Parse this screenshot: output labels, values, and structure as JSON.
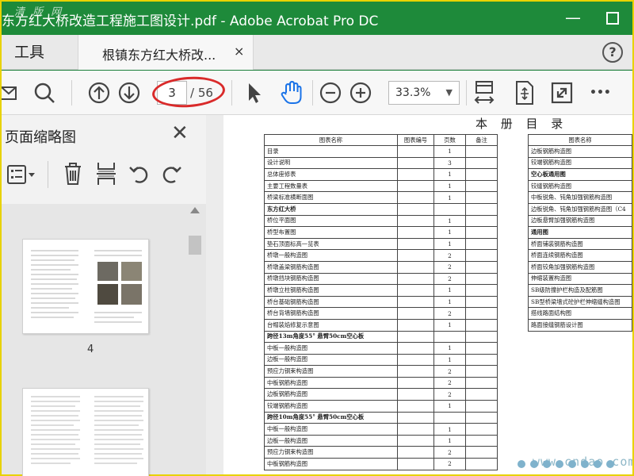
{
  "window": {
    "title": "东方红大桥改造工程施工图设计.pdf - Adobe Acrobat Pro DC",
    "watermark": "清 版 网",
    "minimize": "—",
    "close": "✕"
  },
  "tabs": {
    "tools_label": "工具",
    "doc_label": "根镇东方红大桥改...",
    "doc_close": "×",
    "help": "?"
  },
  "toolbar": {
    "current_page": "3",
    "total_pages": "/ 56",
    "zoom": "33.3%",
    "more": "•••"
  },
  "sidebar": {
    "title": "页面缩略图",
    "close": "✕",
    "visible_page_number": "4"
  },
  "document": {
    "heading": "本 册 目 录",
    "left_table": {
      "headers": [
        "图表名称",
        "图表编号",
        "页数",
        "备注"
      ],
      "rows": [
        {
          "name": "目录",
          "pages": "1",
          "bold": false
        },
        {
          "name": "设计说明",
          "pages": "3",
          "bold": false
        },
        {
          "name": "总体座修表",
          "pages": "1",
          "bold": false
        },
        {
          "name": "主要工程数量表",
          "pages": "1",
          "bold": false
        },
        {
          "name": "桥梁标准横断面图",
          "pages": "1",
          "bold": false
        },
        {
          "name": "东方红大桥",
          "pages": "",
          "bold": true
        },
        {
          "name": "桥位平面图",
          "pages": "1",
          "bold": false
        },
        {
          "name": "桥型布置图",
          "pages": "1",
          "bold": false
        },
        {
          "name": "垫石顶面标高一览表",
          "pages": "1",
          "bold": false
        },
        {
          "name": "桥墩一般构造图",
          "pages": "2",
          "bold": false
        },
        {
          "name": "桥墩盖梁钢筋构造图",
          "pages": "2",
          "bold": false
        },
        {
          "name": "桥墩挡块钢筋构造图",
          "pages": "2",
          "bold": false
        },
        {
          "name": "桥墩立柱钢筋构造图",
          "pages": "1",
          "bold": false
        },
        {
          "name": "桥台基础钢筋构造图",
          "pages": "1",
          "bold": false
        },
        {
          "name": "桥台背墙钢筋构造图",
          "pages": "2",
          "bold": false
        },
        {
          "name": "台帽装焰修复示意图",
          "pages": "1",
          "bold": false
        },
        {
          "name": "跨径13m角度55° 悬臂50cm空心板",
          "pages": "",
          "bold": true
        },
        {
          "name": "中板一般构造图",
          "pages": "1",
          "bold": false
        },
        {
          "name": "边板一般构造图",
          "pages": "1",
          "bold": false
        },
        {
          "name": "预应力钢束构造图",
          "pages": "2",
          "bold": false
        },
        {
          "name": "中板钢筋构造图",
          "pages": "2",
          "bold": false
        },
        {
          "name": "边板钢筋构造图",
          "pages": "2",
          "bold": false
        },
        {
          "name": "铰端钢筋构造图",
          "pages": "1",
          "bold": false
        },
        {
          "name": "跨径10m角度55° 悬臂50cm空心板",
          "pages": "",
          "bold": true
        },
        {
          "name": "中板一般构造图",
          "pages": "1",
          "bold": false
        },
        {
          "name": "边板一般构造图",
          "pages": "1",
          "bold": false
        },
        {
          "name": "预应力钢束构造图",
          "pages": "2",
          "bold": false
        },
        {
          "name": "中板钢筋构造图",
          "pages": "2",
          "bold": false
        }
      ]
    },
    "right_table": {
      "header": "图表名称",
      "rows": [
        {
          "name": "边板钢筋构造图",
          "bold": false
        },
        {
          "name": "铰端钢筋构造图",
          "bold": false
        },
        {
          "name": "空心板通用图",
          "bold": true
        },
        {
          "name": "铰缝钢筋构造图",
          "bold": false
        },
        {
          "name": "中板锐角、钝角加强钢筋构造图",
          "bold": false
        },
        {
          "name": "边板锐角、钝角加强钢筋构造图（C4",
          "bold": false
        },
        {
          "name": "边板悬臂加强钢筋构造图",
          "bold": false
        },
        {
          "name": "通用图",
          "bold": true
        },
        {
          "name": "桥面铺装钢筋构造图",
          "bold": false
        },
        {
          "name": "桥面连续钢筋构造图",
          "bold": false
        },
        {
          "name": "桥面铰角加强钢筋构造图",
          "bold": false
        },
        {
          "name": "伸缩装置构造图",
          "bold": false
        },
        {
          "name": "SB级防撞护栏构造及配筋图",
          "bold": false
        },
        {
          "name": "SB型桥梁墙式砼护栏伸缩缝构造图",
          "bold": false
        },
        {
          "name": "搭线路面结构图",
          "bold": false
        },
        {
          "name": "路面接缝钢筋设计图",
          "bold": false
        }
      ]
    },
    "watermark": "www.cndao.com"
  },
  "colors": {
    "titlebar": "#1e8a3a",
    "frame": "#e8d200",
    "highlight_ellipse": "#d92a2a",
    "accent_hand": "#1a73e8"
  }
}
